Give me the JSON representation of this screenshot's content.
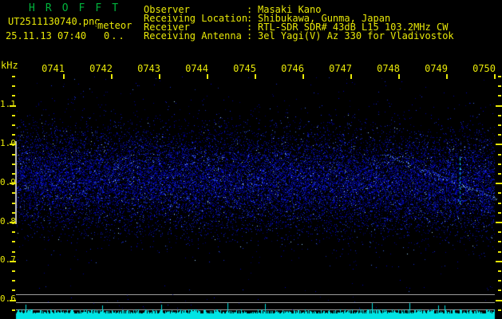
{
  "header": {
    "title": "H R O F F T",
    "filename": "UT2511130740.png",
    "observatory": "meteor",
    "datetime": "25.11.13 07:40",
    "count_info": "0..",
    "fields": [
      {
        "label": "Observer",
        "value": "Masaki Kano"
      },
      {
        "label": "Receiving Location",
        "value": "Shibukawa, Gunma, Japan"
      },
      {
        "label": "Receiver",
        "value": "RTL-SDR SDR# 43dB L15 103.2MHz CW"
      },
      {
        "label": "Receiving Antenna",
        "value": "3el Yagi(V) Az 330 for Vladivostok"
      }
    ]
  },
  "chart_data": {
    "type": "heatmap",
    "title": "HROFFT 10-minute radio meteor observation spectrogram",
    "ylabel": "kHz",
    "x_ticks": [
      "0741",
      "0742",
      "0743",
      "0744",
      "0745",
      "0746",
      "0747",
      "0748",
      "0749",
      "0750"
    ],
    "x_range_utc": [
      "07:40",
      "07:50"
    ],
    "y_ticks": [
      "1.1",
      "1.0",
      "0.9",
      "0.8",
      "0.7",
      "0.6"
    ],
    "y_range_khz": [
      0.58,
      1.19
    ],
    "grid": false,
    "noise_band": {
      "freq_low_khz": 0.78,
      "freq_high_khz": 1.04,
      "peak_khz": 0.92,
      "description": "continuous speckled blue background-noise band across all 10 minutes"
    },
    "band_marker_khz": [
      0.8,
      1.0
    ],
    "features": [
      {
        "type": "meteor-echo-doppler-trail",
        "time_start_utc": "07:47.6",
        "time_end_utc": "07:50.0",
        "freq_start_khz": 0.98,
        "freq_end_khz": 0.86
      },
      {
        "type": "dashed-vertical-signal",
        "time_utc": "07:49.3",
        "freq_low_khz": 0.84,
        "freq_high_khz": 0.97
      }
    ],
    "reference_lines_khz": [
      0.613,
      0.592,
      0.574
    ],
    "bottom_trace": {
      "name": "signal level trace",
      "color": "#00e4e4"
    }
  },
  "colors": {
    "background": "#000000",
    "text_yellow": "#e8e808",
    "title_green": "#00b43c",
    "trace_cyan": "#00e4e4",
    "noise_blue": "#1828c8",
    "ref_gray": "#9a9a9a"
  }
}
